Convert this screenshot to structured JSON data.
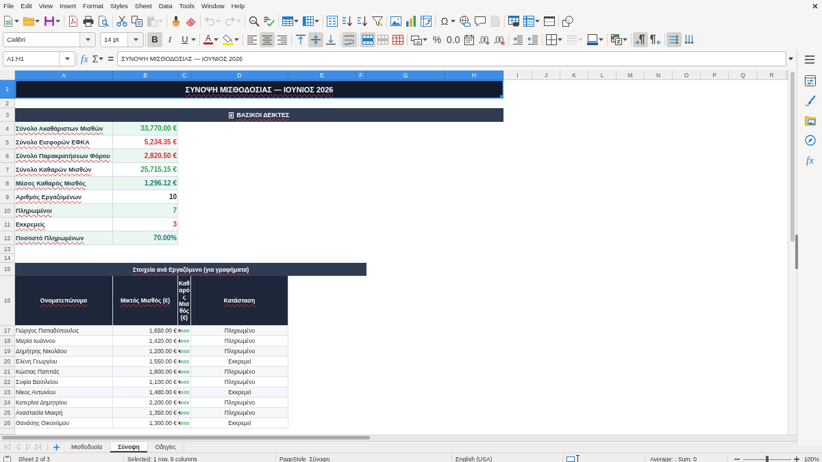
{
  "menu_bar": {
    "items": [
      "File",
      "Edit",
      "View",
      "Insert",
      "Format",
      "Styles",
      "Sheet",
      "Data",
      "Tools",
      "Window",
      "Help"
    ]
  },
  "standard_toolbar": {
    "paste": {
      "disabled": true
    },
    "undo": {
      "disabled": true
    },
    "redo": {
      "disabled": true
    },
    "special_character": {
      "label": "Ω"
    },
    "headers_footers": {
      "disabled": true
    }
  },
  "formatting_toolbar": {
    "font_name": "Calibri",
    "font_substituted": true,
    "font_size": "14 pt",
    "bold": {
      "label": "B",
      "on": true
    },
    "italic": {
      "label": "I",
      "on": false
    },
    "underline": {
      "label": "U",
      "on": false
    },
    "font_color": {
      "label": "A"
    },
    "horizontal_align": [
      {
        "kind": "left",
        "selected": false
      },
      {
        "kind": "center",
        "selected": true
      },
      {
        "kind": "right",
        "selected": false
      }
    ],
    "vertical_align": [
      {
        "kind": "top",
        "selected": false
      },
      {
        "kind": "center",
        "selected": true
      },
      {
        "kind": "bottom",
        "selected": false
      }
    ],
    "wrap_text": true,
    "merge_and_center": true,
    "percent": {
      "label": "%"
    },
    "number": {
      "label": "0.0"
    },
    "border_style": {
      "disabled": true
    },
    "paragraph_direction": [
      {
        "kind": "ltr",
        "selected": true
      },
      {
        "kind": "rtl",
        "selected": false
      }
    ],
    "text_direction": [
      {
        "kind": "horizontal",
        "selected": true
      },
      {
        "kind": "vertical",
        "selected": false
      }
    ]
  },
  "formula_bar": {
    "name_box": "A1:H1",
    "function_wizard": "fx",
    "sum": "Σ",
    "formula": "=",
    "content": "ΣΥΝΟΨΗ ΜΙΣΘΟΔΟΣΙΑΣ — ΙΟΥΝΙΟΣ 2026"
  },
  "sidebar": {
    "functions": "fx"
  },
  "sheet": {
    "columns": [
      {
        "label": "A",
        "selected": true
      },
      {
        "label": "B",
        "selected": true
      },
      {
        "label": "C",
        "selected": true
      },
      {
        "label": "D",
        "selected": true
      },
      {
        "label": "E",
        "selected": true
      },
      {
        "label": "F",
        "selected": true
      },
      {
        "label": "G",
        "selected": true
      },
      {
        "label": "H",
        "selected": true
      },
      {
        "label": "I",
        "selected": false
      },
      {
        "label": "J",
        "selected": false
      },
      {
        "label": "K",
        "selected": false
      },
      {
        "label": "L",
        "selected": false
      },
      {
        "label": "M",
        "selected": false
      },
      {
        "label": "N",
        "selected": false
      },
      {
        "label": "O",
        "selected": false
      },
      {
        "label": "P",
        "selected": false
      },
      {
        "label": "Q",
        "selected": false
      },
      {
        "label": "R",
        "selected": false
      }
    ],
    "rows": [
      {
        "label": "1",
        "selected": true
      },
      {
        "label": "2",
        "selected": false
      },
      {
        "label": "3",
        "selected": false
      },
      {
        "label": "4",
        "selected": false
      },
      {
        "label": "5",
        "selected": false
      },
      {
        "label": "6",
        "selected": false
      },
      {
        "label": "7",
        "selected": false
      },
      {
        "label": "8",
        "selected": false
      },
      {
        "label": "9",
        "selected": false
      },
      {
        "label": "10",
        "selected": false
      },
      {
        "label": "11",
        "selected": false
      },
      {
        "label": "12",
        "selected": false
      },
      {
        "label": "13",
        "selected": false
      },
      {
        "label": "14",
        "selected": false
      },
      {
        "label": "15",
        "selected": false
      },
      {
        "label": "16",
        "selected": false
      },
      {
        "label": "17",
        "selected": false
      },
      {
        "label": "18",
        "selected": false
      },
      {
        "label": "19",
        "selected": false
      },
      {
        "label": "20",
        "selected": false
      },
      {
        "label": "21",
        "selected": false
      },
      {
        "label": "22",
        "selected": false
      },
      {
        "label": "23",
        "selected": false
      },
      {
        "label": "24",
        "selected": false
      },
      {
        "label": "25",
        "selected": false
      },
      {
        "label": "26",
        "selected": false
      }
    ],
    "title": {
      "text": "ΣΥΝΟΨΗ ΜΙΣΘΟΔΟΣΙΑΣ — ΙΟΥΝΙΟΣ 2026",
      "selected": true,
      "spell_marked": true
    },
    "kpi_header": {
      "text": "ΒΑΣΙΚΟΙ ΔΕΙΚΤΕΣ",
      "spell_marked": true
    },
    "kpis": [
      {
        "label": "Σύνολο Ακαθάριστων Μισθών",
        "value": "33,770.00 €",
        "color": "#2e9e4e",
        "spell_marked": true
      },
      {
        "label": "Σύνολο Εισφορών ΕΦΚΑ",
        "value": "5,234.35 €",
        "color": "#dc2f2f",
        "spell_marked": true
      },
      {
        "label": "Σύνολο Παρακρατήσεων Φόρου",
        "value": "2,820.50 €",
        "color": "#dc2f2f",
        "spell_marked": true
      },
      {
        "label": "Σύνολο Καθαρών Μισθών",
        "value": "25,715.15 €",
        "color": "#2e9e4e",
        "spell_marked": true
      },
      {
        "label": "Μέσος Καθαρός Μισθός",
        "value": "1,296.12 €",
        "color": "#1f7d72",
        "spell_marked": true
      },
      {
        "label": "Αριθμός Εργαζομένων",
        "value": "10",
        "color": "#1e293b",
        "spell_marked": true
      },
      {
        "label": "Πληρωμένοι",
        "value": "7",
        "color": "#2e9e4e",
        "spell_marked": true
      },
      {
        "label": "Εκκρεμείς",
        "value": "3",
        "color": "#dc2f2f",
        "spell_marked": true
      },
      {
        "label": "Ποσοστό Πληρωμένων",
        "value": "70.00%",
        "color": "#1f7d72",
        "spell_marked": true
      }
    ],
    "employee_table": {
      "title": {
        "text": "Στοιχεία ανά Εργαζόμενο (για γραφήματα)",
        "spell_marked": true
      },
      "columns": [
        {
          "label": "Ονοματεπώνυμο",
          "spell_marked": true
        },
        {
          "label": "Μικτός Μισθός (€)",
          "spell_marked": true
        },
        {
          "label": "Καθαρός Μισθός (€)",
          "spell_marked": false
        },
        {
          "label": "Κατάσταση",
          "spell_marked": true
        }
      ],
      "rows": [
        {
          "name": "Γιώργος Παπαδόπουλος",
          "gross": "1,650.00 €",
          "net": "###",
          "status": "Πληρωμένο"
        },
        {
          "name": "Μαρία Ιωάννου",
          "gross": "1,420.00 €",
          "net": "###",
          "status": "Πληρωμένο"
        },
        {
          "name": "Δημήτρης Νικολάου",
          "gross": "1,200.00 €",
          "net": "###",
          "status": "Πληρωμένο"
        },
        {
          "name": "Ελένη Γεωργίου",
          "gross": "1,550.00 €",
          "net": "###",
          "status": "Εκκρεμεί"
        },
        {
          "name": "Κώστας Παππάς",
          "gross": "1,800.00 €",
          "net": "###",
          "status": "Πληρωμένο"
        },
        {
          "name": "Σοφία Βασιλείου",
          "gross": "1,100.00 €",
          "net": "###",
          "status": "Πληρωμένο"
        },
        {
          "name": "Νίκος Αντωνίου",
          "gross": "1,480.00 €",
          "net": "###",
          "status": "Εκκρεμεί"
        },
        {
          "name": "Κατερίνα Δημητρίου",
          "gross": "2,200.00 €",
          "net": "###",
          "status": "Πληρωμένο"
        },
        {
          "name": "Αναστασία Μακρή",
          "gross": "1,350.00 €",
          "net": "###",
          "status": "Πληρωμένο"
        },
        {
          "name": "Θανάσης Οικονόμου",
          "gross": "1,300.00 €",
          "net": "###",
          "status": "Εκκρεμεί"
        }
      ]
    }
  },
  "sheet_tab_bar": {
    "navigation_disabled": true,
    "tabs": [
      {
        "label": "Μισθοδοσία",
        "selected": false
      },
      {
        "label": "Σύνοψη",
        "selected": true
      },
      {
        "label": "Οδηγίες",
        "selected": false
      }
    ]
  },
  "status_bar": {
    "sheet_position": "Sheet 2 of 3",
    "selection": "Selected: 1 row, 8 columns",
    "page_style": "PageStyle_Σύνοψη",
    "language": "English (USA)",
    "summary": "Average: ; Sum: 0",
    "zoom": {
      "level": 0.5,
      "reading": "100%"
    }
  }
}
